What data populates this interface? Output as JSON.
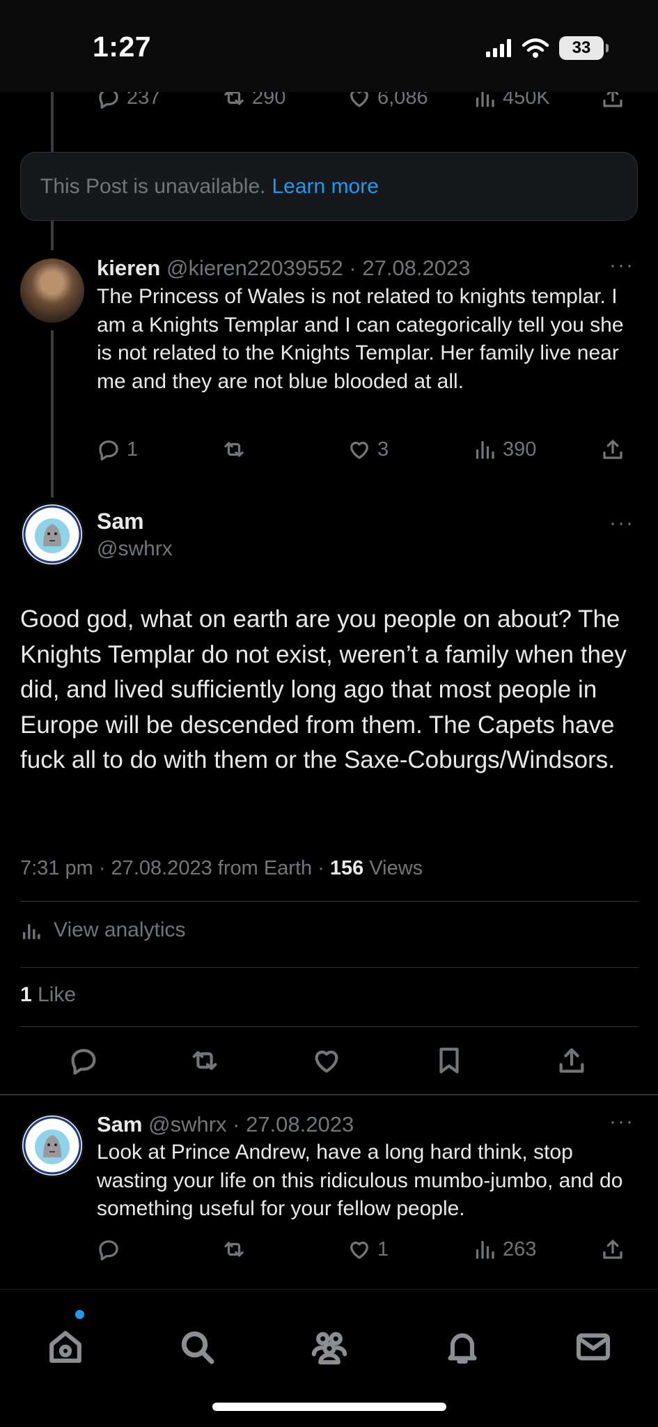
{
  "status_bar": {
    "time": "1:27",
    "battery": "33"
  },
  "top_tweet_stats": {
    "replies": "237",
    "retweets": "290",
    "likes": "6,086",
    "views": "450K"
  },
  "unavailable": {
    "text": "This Post is unavailable.",
    "link": "Learn more"
  },
  "reply_kieren": {
    "name": "kieren",
    "meta": "@kieren22039552 · 27.08.2023",
    "text": "The Princess of Wales is not related to knights templar. I am a Knights Templar and I can categorically tell you she is not related to the Knights Templar. Her family live near me and they are not blue blooded at all.",
    "replies": "1",
    "likes": "3",
    "views": "390"
  },
  "main_tweet": {
    "name": "Sam",
    "handle": "@swhrx",
    "text": "Good god, what on earth are you people on about? The Knights Templar do not exist, weren’t a family when they did, and lived sufficiently long ago that most people in Europe will be descended from them. The Capets have fuck all to do with them or the Saxe-Coburgs/Windsors.",
    "meta_prefix": "7:31 pm · 27.08.2023 from Earth · ",
    "views_count": "156",
    "views_label": " Views",
    "analytics": "View analytics",
    "likes_count": "1",
    "likes_label": " Like"
  },
  "reply_sam": {
    "name": "Sam",
    "meta": "@swhrx · 27.08.2023",
    "text": "Look at Prince Andrew, have a long hard think, stop wasting your life on this ridiculous mumbo-jumbo, and do something useful for your fellow people.",
    "likes": "1",
    "views": "263"
  },
  "more_label": "···",
  "colors": {
    "accent": "#1d9bf0",
    "muted": "#71767b",
    "text": "#e7e9ea",
    "background": "#000000"
  },
  "nav_icons": [
    "home-icon",
    "search-icon",
    "communities-icon",
    "notifications-icon",
    "messages-icon"
  ]
}
